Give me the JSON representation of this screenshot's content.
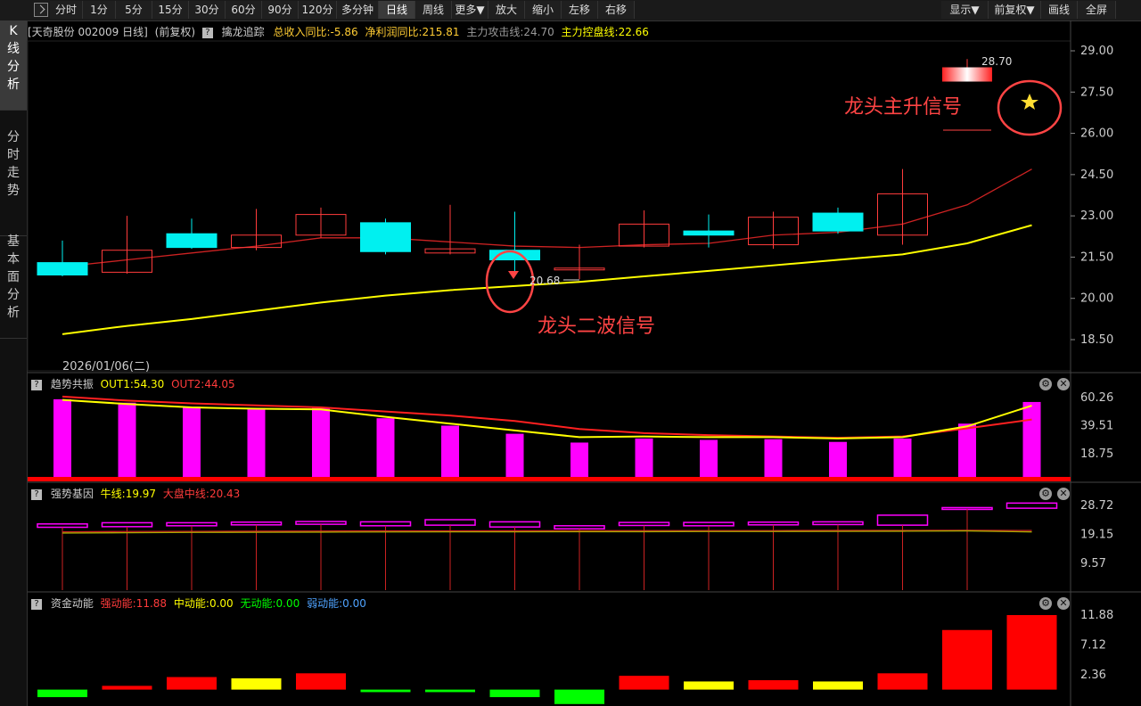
{
  "toolbar": {
    "buttons": [
      "分时",
      "1分",
      "5分",
      "15分",
      "30分",
      "60分",
      "90分",
      "120分",
      "多分钟",
      "日线",
      "周线",
      "更多▼",
      "放大",
      "缩小",
      "左移",
      "右移"
    ],
    "active": "日线",
    "right_buttons": [
      "显示▼",
      "前复权▼",
      "画线",
      "全屏"
    ]
  },
  "sidebar": {
    "tabs": [
      "K线分析",
      "分时走势",
      "基本面分析"
    ]
  },
  "main": {
    "stock": "[天奇股份 002009 日线]",
    "adjust": "(前复权)",
    "indicator": "擒龙追踪",
    "rev_label": "总收入同比:-5.86",
    "profit_label": "净利润同比:215.81",
    "attack_label": "主力攻击线:24.70",
    "control_label": "主力控盘线:22.66",
    "price_tag": "20.68",
    "high_tag": "28.70",
    "date_label": "2026/01/06(二)",
    "annotation_top": "龙头主升信号",
    "annotation_bottom": "龙头二波信号",
    "y_ticks": [
      "29.00",
      "27.50",
      "26.00",
      "24.50",
      "23.00",
      "21.50",
      "20.00",
      "18.50"
    ]
  },
  "panel1": {
    "title": "趋势共振",
    "out1": "OUT1:54.30",
    "out2": "OUT2:44.05",
    "y_ticks": [
      "60.26",
      "39.51",
      "18.75"
    ]
  },
  "panel2": {
    "title": "强势基因",
    "bull": "牛线:19.97",
    "market": "大盘中线:20.43",
    "y_ticks": [
      "28.72",
      "19.15",
      "9.57"
    ]
  },
  "panel3": {
    "title": "资金动能",
    "strong": "强动能:11.88",
    "mid": "中动能:0.00",
    "none": "无动能:0.00",
    "weak": "弱动能:0.00",
    "y_ticks": [
      "11.88",
      "7.12",
      "2.36"
    ]
  },
  "colors": {
    "up": "#ff3b3b",
    "down": "#00f0f0",
    "yellow": "#ffff00",
    "magenta": "#ff00ff",
    "green": "#00ff00"
  },
  "chart_data": {
    "type": "candlestick",
    "candles": [
      {
        "o": 21.3,
        "c": 20.85,
        "h": 22.1,
        "l": 20.8
      },
      {
        "o": 20.95,
        "c": 21.75,
        "h": 23.0,
        "l": 20.9
      },
      {
        "o": 22.35,
        "c": 21.85,
        "h": 22.9,
        "l": 21.8
      },
      {
        "o": 21.85,
        "c": 22.3,
        "h": 23.25,
        "l": 21.75
      },
      {
        "o": 22.3,
        "c": 23.05,
        "h": 23.3,
        "l": 22.2
      },
      {
        "o": 22.75,
        "c": 21.7,
        "h": 22.9,
        "l": 21.6
      },
      {
        "o": 21.65,
        "c": 21.8,
        "h": 23.4,
        "l": 21.6
      },
      {
        "o": 21.75,
        "c": 21.4,
        "h": 23.15,
        "l": 20.9
      },
      {
        "o": 21.1,
        "c": 21.1,
        "h": 21.95,
        "l": 20.7
      },
      {
        "o": 21.9,
        "c": 22.7,
        "h": 23.2,
        "l": 21.85
      },
      {
        "o": 22.45,
        "c": 22.3,
        "h": 23.05,
        "l": 21.85
      },
      {
        "o": 21.95,
        "c": 22.95,
        "h": 23.15,
        "l": 21.8
      },
      {
        "o": 23.1,
        "c": 22.45,
        "h": 23.3,
        "l": 22.35
      },
      {
        "o": 22.3,
        "c": 23.8,
        "h": 24.7,
        "l": 21.95
      },
      {
        "o": 28.4,
        "c": 28.4,
        "h": 28.7,
        "l": 28.0
      }
    ],
    "attack_line": [
      21.15,
      21.4,
      21.65,
      21.9,
      22.2,
      22.2,
      22.05,
      21.9,
      21.85,
      21.95,
      22.0,
      22.3,
      22.4,
      22.7,
      23.4,
      24.7
    ],
    "control_line": [
      18.7,
      19.0,
      19.25,
      19.55,
      19.85,
      20.1,
      20.3,
      20.45,
      20.6,
      20.8,
      21.0,
      21.2,
      21.4,
      21.6,
      22.0,
      22.66
    ],
    "panel1_bars": [
      59.0,
      56.5,
      53.5,
      52.5,
      52.5,
      45.0,
      39.5,
      33.5,
      27.0,
      30.0,
      29.0,
      29.5,
      27.5,
      30.0,
      41.0,
      57.0
    ],
    "panel1_out1": [
      58.5,
      55.5,
      53.0,
      52.0,
      51.5,
      46.0,
      41.0,
      36.0,
      31.0,
      31.5,
      31.0,
      31.0,
      30.0,
      31.0,
      39.0,
      54.3
    ],
    "panel1_out2": [
      61.0,
      58.0,
      56.0,
      54.5,
      53.0,
      50.0,
      47.0,
      43.0,
      37.0,
      34.0,
      32.5,
      31.5,
      30.5,
      31.5,
      37.5,
      44.05
    ],
    "panel2_bull": [
      19.6,
      19.7,
      19.8,
      19.85,
      19.9,
      19.95,
      20.0,
      20.0,
      20.05,
      20.05,
      20.1,
      20.1,
      20.15,
      20.2,
      20.3,
      19.97
    ],
    "panel2_market": [
      20.0,
      20.1,
      20.15,
      20.2,
      20.25,
      20.3,
      20.3,
      20.35,
      20.35,
      20.4,
      20.4,
      20.4,
      20.45,
      20.45,
      20.5,
      20.43
    ],
    "panel2_boxes": [
      [
        21.5,
        22.6
      ],
      [
        21.7,
        23.0
      ],
      [
        22.0,
        23.0
      ],
      [
        22.3,
        23.2
      ],
      [
        22.5,
        23.4
      ],
      [
        22.0,
        23.3
      ],
      [
        22.2,
        24.0
      ],
      [
        21.6,
        23.3
      ],
      [
        21.0,
        22.0
      ],
      [
        22.1,
        23.1
      ],
      [
        22.0,
        23.1
      ],
      [
        22.3,
        23.2
      ],
      [
        22.4,
        23.3
      ],
      [
        22.2,
        25.5
      ],
      [
        27.5,
        28.0
      ],
      [
        27.8,
        29.5
      ]
    ],
    "panel3_bars": [
      {
        "v": 1.2,
        "c": "green",
        "neg": true
      },
      {
        "v": 0.6,
        "c": "red"
      },
      {
        "v": 2.0,
        "c": "red"
      },
      {
        "v": 1.8,
        "c": "yellow"
      },
      {
        "v": 2.6,
        "c": "red"
      },
      {
        "v": 0.4,
        "c": "green",
        "neg": true
      },
      {
        "v": 0.4,
        "c": "green",
        "neg": true
      },
      {
        "v": 1.2,
        "c": "green",
        "neg": true
      },
      {
        "v": 2.3,
        "c": "green",
        "neg": true
      },
      {
        "v": 2.2,
        "c": "red"
      },
      {
        "v": 1.3,
        "c": "yellow"
      },
      {
        "v": 1.5,
        "c": "red"
      },
      {
        "v": 1.3,
        "c": "yellow"
      },
      {
        "v": 2.6,
        "c": "red"
      },
      {
        "v": 9.5,
        "c": "red"
      },
      {
        "v": 11.88,
        "c": "red"
      }
    ]
  }
}
